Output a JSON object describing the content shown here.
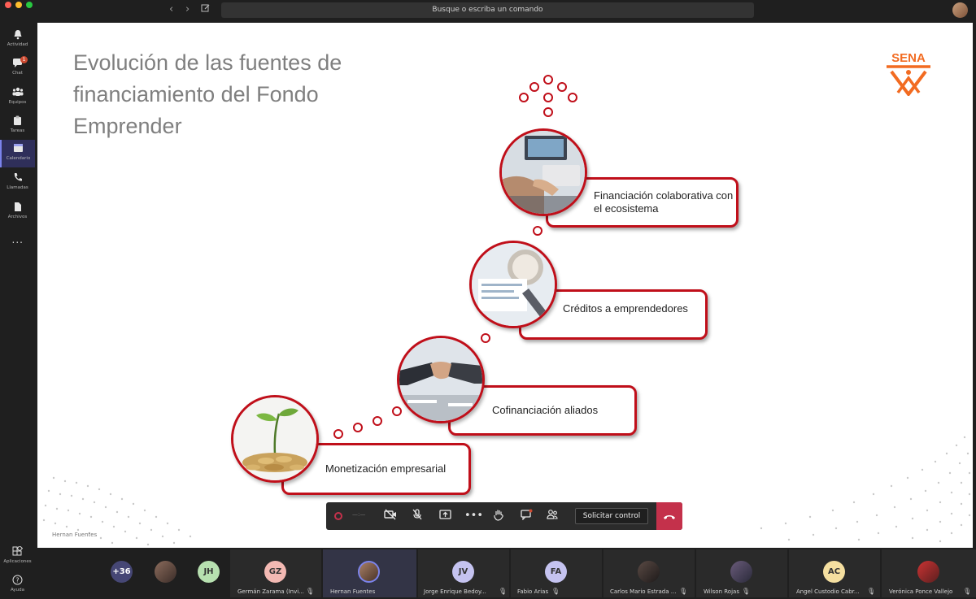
{
  "app": {
    "search_placeholder": "Busque o escriba un comando"
  },
  "rail": {
    "items": [
      {
        "label": "Actividad",
        "icon": "bell-icon"
      },
      {
        "label": "Chat",
        "icon": "chat-icon",
        "badge": "1"
      },
      {
        "label": "Equipos",
        "icon": "teams-icon"
      },
      {
        "label": "Tareas",
        "icon": "tasks-icon"
      },
      {
        "label": "Calendario",
        "icon": "calendar-icon",
        "active": true
      },
      {
        "label": "Llamadas",
        "icon": "phone-icon"
      },
      {
        "label": "Archivos",
        "icon": "files-icon"
      },
      {
        "label": "...",
        "icon": "more-icon"
      }
    ],
    "apps_label": "Aplicaciones",
    "help_label": "Ayuda"
  },
  "slide": {
    "title": "Evolución de las fuentes de financiamiento del Fondo Emprender",
    "logo_text": "SENA",
    "presenter_label": "Hernan Fuentes",
    "steps": [
      {
        "label": "Monetización empresarial"
      },
      {
        "label": "Cofinanciación aliados"
      },
      {
        "label": "Créditos a emprendedores"
      },
      {
        "label": "Financiación colaborativa con el ecosistema"
      }
    ],
    "colors": {
      "accent": "#c00f1a",
      "sena_orange": "#f26b21"
    }
  },
  "controls": {
    "request_control_label": "Solicitar control",
    "timer": "—:—"
  },
  "participants": {
    "overflow": "+36",
    "tiles": [
      {
        "initials": "",
        "name": "",
        "type": "photo"
      },
      {
        "initials": "JH",
        "name": "",
        "color": "#b7e0b0"
      },
      {
        "initials": "GZ",
        "name": "Germán Zarama (Invi...",
        "color": "#f3b9b3"
      },
      {
        "initials": "",
        "name": "Hernan Fuentes",
        "type": "photo",
        "speaking": true
      },
      {
        "initials": "JV",
        "name": "Jorge Enrique Bedoy...",
        "color": "#c5c3f0"
      },
      {
        "initials": "FA",
        "name": "Fabio Arias",
        "color": "#c5c3f0"
      },
      {
        "initials": "",
        "name": "Carlos Mario Estrada ...",
        "type": "photo"
      },
      {
        "initials": "",
        "name": "Wilson Rojas",
        "type": "photo"
      },
      {
        "initials": "AC",
        "name": "Angel Custodio Cabr...",
        "color": "#f5dfa0"
      },
      {
        "initials": "",
        "name": "Verónica Ponce Vallejo",
        "type": "photo"
      }
    ]
  }
}
